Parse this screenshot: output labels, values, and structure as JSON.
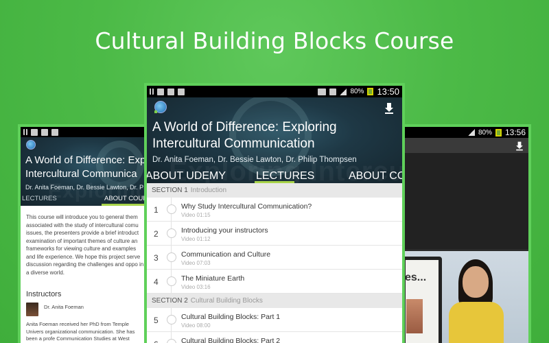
{
  "headline": "Cultural Building Blocks Course",
  "colors": {
    "background": "#4cba47",
    "frame": "#5fd05a",
    "accent": "#a8d44a",
    "hero": "#1e3845"
  },
  "center_phone": {
    "status_bar": {
      "icons": [
        "usb-icon",
        "notification-icon",
        "notification-icon",
        "image-icon"
      ],
      "signal": "80%",
      "time": "13:50"
    },
    "watermark": "Exploring Intercultural",
    "course_title": "A World of Difference: Exploring Intercultural Communication",
    "course_title_line1": "A World of Difference: Exploring",
    "course_title_line2": "Intercultural Communication",
    "authors": "Dr. Anita Foeman, Dr. Bessie Lawton, Dr. Philip Thompsen",
    "tabs": [
      {
        "label": "ABOUT UDEMY"
      },
      {
        "label": "LECTURES",
        "active": true
      },
      {
        "label": "ABOUT COURSE"
      }
    ],
    "sections": [
      {
        "label": "SECTION 1",
        "name": "Introduction",
        "lectures": [
          {
            "num": "1",
            "title": "Why Study Intercultural Communication?",
            "sub": "Video 01:15"
          },
          {
            "num": "2",
            "title": "Introducing your instructors",
            "sub": "Video 01:12"
          },
          {
            "num": "3",
            "title": "Communication and Culture",
            "sub": "Video 07:03"
          },
          {
            "num": "4",
            "title": "The Miniature Earth",
            "sub": "Video 03:16"
          }
        ]
      },
      {
        "label": "SECTION 2",
        "name": "Cultural Building Blocks",
        "lectures": [
          {
            "num": "5",
            "title": "Cultural Building Blocks: Part 1",
            "sub": "Video 08:00"
          },
          {
            "num": "6",
            "title": "Cultural Building Blocks: Part 2",
            "sub": ""
          }
        ]
      }
    ]
  },
  "left_phone": {
    "title_line1": "A World of Difference: Exp",
    "title_line2": "Intercultural Communica",
    "authors": "Dr. Anita Foeman, Dr. Bessie Lawton, Dr. P",
    "tabs": [
      {
        "label": "LECTURES"
      },
      {
        "label": "ABOUT COURS",
        "active": true
      }
    ],
    "about_text": "This course will introduce you to general them associated with the study of intercultural comu issues, the presenters provide a brief introduct examination of important themes of culture an frameworks for viewing culture and examples and life experience. We hope this project serve discussion regarding the challenges and oppo in a diverse world.",
    "instructors_heading": "Instructors",
    "instructor_name": "Dr. Anita Foeman",
    "instructor_bio": "Anita Foeman received her PhD from Temple Univers organizational communication. She has been a profe Communication Studies at West Chester University s"
  },
  "right_phone": {
    "status_bar": {
      "signal": "80%",
      "time": "13:56"
    },
    "video_text": "es..."
  }
}
